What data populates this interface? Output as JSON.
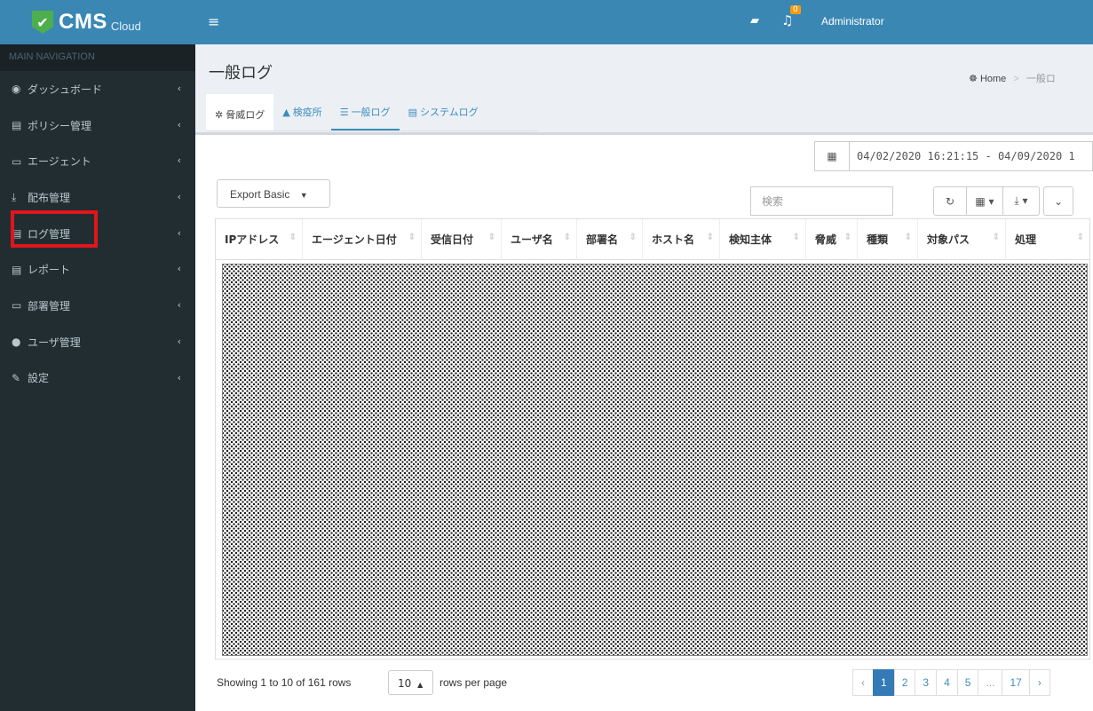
{
  "app": {
    "logo_text": "CMS",
    "logo_sub": "Cloud"
  },
  "sidebar": {
    "header": "MAIN NAVIGATION",
    "items": [
      {
        "label": "ダッシュボード",
        "icon": "dashboard-icon"
      },
      {
        "label": "ポリシー管理",
        "icon": "policy-icon"
      },
      {
        "label": "エージェント",
        "icon": "monitor-icon"
      },
      {
        "label": "配布管理",
        "icon": "download-icon"
      },
      {
        "label": "ログ管理",
        "icon": "log-icon"
      },
      {
        "label": "レポート",
        "icon": "report-icon"
      },
      {
        "label": "部署管理",
        "icon": "folder-icon"
      },
      {
        "label": "ユーザ管理",
        "icon": "user-icon"
      },
      {
        "label": "設定",
        "icon": "wrench-icon"
      }
    ],
    "highlight_color": "#e0161b"
  },
  "topbar": {
    "user": "Administrator",
    "notification_count": "0"
  },
  "page": {
    "title": "一般ログ",
    "breadcrumb": {
      "home": "Home",
      "current": "一般ロ"
    }
  },
  "tabs": [
    {
      "label": "脅威ログ"
    },
    {
      "label": "検疫所"
    },
    {
      "label": "一般ログ"
    },
    {
      "label": "システムログ"
    }
  ],
  "filters": {
    "date_range": "04/02/2020 16:21:15 - 04/09/2020 1",
    "export_label": "Export Basic",
    "search_placeholder": "検索"
  },
  "table": {
    "columns": [
      "IPアドレス",
      "エージェント日付",
      "受信日付",
      "ユーザ名",
      "部署名",
      "ホスト名",
      "検知主体",
      "脅威",
      "種類",
      "対象パス",
      "処理"
    ]
  },
  "footer": {
    "showing": "Showing 1 to 10 of 161 rows",
    "page_size": "10",
    "rows_label": "rows per page",
    "pages": [
      "‹",
      "1",
      "2",
      "3",
      "4",
      "5",
      "...",
      "17",
      "›"
    ],
    "active_page": "1"
  }
}
